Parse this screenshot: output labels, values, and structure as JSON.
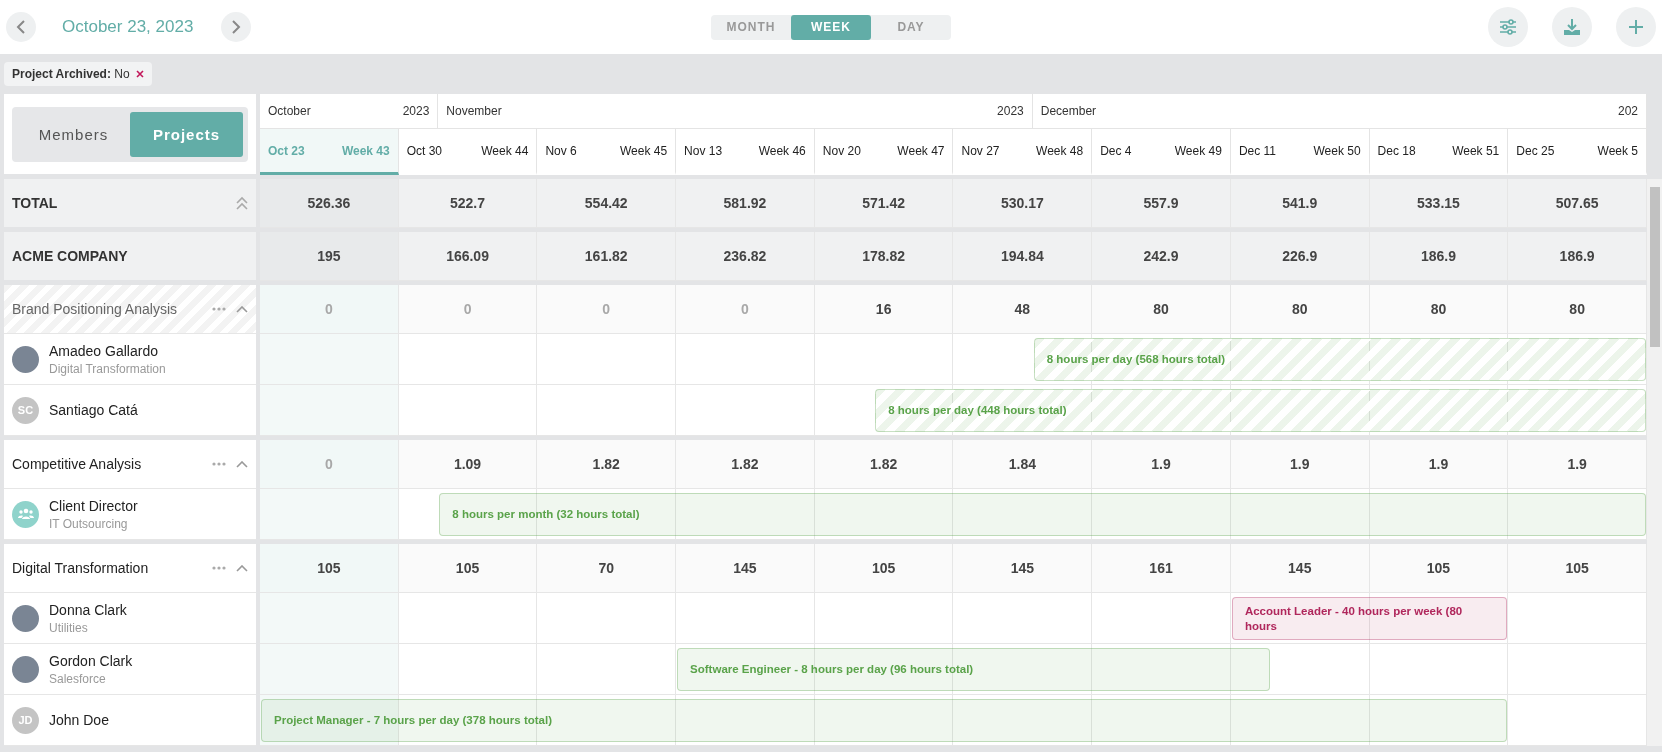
{
  "top_bar": {
    "date": "October 23, 2023",
    "views": [
      {
        "label": "MONTH",
        "selected": false
      },
      {
        "label": "WEEK",
        "selected": true
      },
      {
        "label": "DAY",
        "selected": false
      }
    ]
  },
  "filters": [
    {
      "label": "Project Archived:",
      "value": "No"
    }
  ],
  "mode_toggle": [
    {
      "label": "Members",
      "selected": false
    },
    {
      "label": "Projects",
      "selected": true
    }
  ],
  "months": [
    {
      "label": "October",
      "year": "2023"
    },
    {
      "label": "November",
      "year": "2023"
    },
    {
      "label": "December",
      "year": "202"
    }
  ],
  "weeks": [
    {
      "date": "Oct 23",
      "week": "Week 43",
      "selected": true
    },
    {
      "date": "Oct 30",
      "week": "Week 44",
      "selected": false
    },
    {
      "date": "Nov 6",
      "week": "Week 45",
      "selected": false
    },
    {
      "date": "Nov 13",
      "week": "Week 46",
      "selected": false
    },
    {
      "date": "Nov 20",
      "week": "Week 47",
      "selected": false
    },
    {
      "date": "Nov 27",
      "week": "Week 48",
      "selected": false
    },
    {
      "date": "Dec 4",
      "week": "Week 49",
      "selected": false
    },
    {
      "date": "Dec 11",
      "week": "Week 50",
      "selected": false
    },
    {
      "date": "Dec 18",
      "week": "Week 51",
      "selected": false
    },
    {
      "date": "Dec 25",
      "week": "Week 5",
      "selected": false
    }
  ],
  "summary_rows": [
    {
      "kind": "total",
      "label": "TOTAL",
      "values": [
        "526.36",
        "522.7",
        "554.42",
        "581.92",
        "571.42",
        "530.17",
        "557.9",
        "541.9",
        "533.15",
        "507.65"
      ]
    },
    {
      "kind": "client",
      "label": "ACME COMPANY",
      "values": [
        "195",
        "166.09",
        "161.82",
        "236.82",
        "178.82",
        "194.84",
        "242.9",
        "226.9",
        "186.9",
        "186.9"
      ]
    }
  ],
  "projects": [
    {
      "name": "Brand Positioning Analysis",
      "tentative": true,
      "cells": [
        {
          "value": "0",
          "muted": true
        },
        {
          "value": "0",
          "muted": true
        },
        {
          "value": "0",
          "muted": true
        },
        {
          "value": "0",
          "muted": true
        },
        {
          "value": "16",
          "muted": false
        },
        {
          "value": "48",
          "muted": false
        },
        {
          "value": "80",
          "muted": false
        },
        {
          "value": "80",
          "muted": false
        },
        {
          "value": "80",
          "muted": false
        },
        {
          "value": "80",
          "muted": false
        }
      ],
      "members": [
        {
          "name": "Amadeo Gallardo",
          "subtitle": "Digital Transformation",
          "avatar": {
            "kind": "photo"
          },
          "bar": {
            "label": "8 hours per day (568 hours total)",
            "striped": true,
            "color": "#5aa34a"
          }
        },
        {
          "name": "Santiago Catá",
          "avatar": {
            "kind": "initials",
            "initials": "SC"
          },
          "bar": {
            "label": "8 hours per day (448 hours total)",
            "striped": true,
            "color": "#5aa34a"
          }
        }
      ]
    },
    {
      "name": "Competitive Analysis",
      "tentative": false,
      "cells": [
        {
          "value": "0",
          "muted": true
        },
        {
          "value": "1.09",
          "muted": false
        },
        {
          "value": "1.82",
          "muted": false
        },
        {
          "value": "1.82",
          "muted": false
        },
        {
          "value": "1.82",
          "muted": false
        },
        {
          "value": "1.84",
          "muted": false
        },
        {
          "value": "1.9",
          "muted": false
        },
        {
          "value": "1.9",
          "muted": false
        },
        {
          "value": "1.9",
          "muted": false
        },
        {
          "value": "1.9",
          "muted": false
        }
      ],
      "members": [
        {
          "name": "Client Director",
          "subtitle": "IT Outsourcing",
          "avatar": {
            "kind": "role"
          },
          "bar": {
            "label": "8 hours per month (32 hours total)",
            "striped": false,
            "color": "#5aa34a"
          }
        }
      ]
    },
    {
      "name": "Digital Transformation",
      "tentative": false,
      "cells": [
        {
          "value": "105",
          "muted": false
        },
        {
          "value": "105",
          "muted": false
        },
        {
          "value": "70",
          "muted": false
        },
        {
          "value": "145",
          "muted": false
        },
        {
          "value": "105",
          "muted": false
        },
        {
          "value": "145",
          "muted": false
        },
        {
          "value": "161",
          "muted": false
        },
        {
          "value": "145",
          "muted": false
        },
        {
          "value": "105",
          "muted": false
        },
        {
          "value": "105",
          "muted": false
        }
      ],
      "members": [
        {
          "name": "Donna Clark",
          "subtitle": "Utilities",
          "avatar": {
            "kind": "photo"
          },
          "bar": {
            "label": "Account Leader - 40 hours per week (80 hours",
            "striped": false,
            "color": "#b0275c"
          }
        },
        {
          "name": "Gordon Clark",
          "subtitle": "Salesforce",
          "avatar": {
            "kind": "photo"
          },
          "bar": {
            "label": "Software Engineer - 8 hours per day (96 hours total)",
            "striped": false,
            "color": "#5aa34a"
          }
        },
        {
          "name": "John Doe",
          "avatar": {
            "kind": "initials",
            "initials": "JD"
          },
          "bar": {
            "label": "Project Manager - 7 hours per day (378 hours total)",
            "striped": false,
            "color": "#5aa34a"
          }
        }
      ]
    }
  ]
}
